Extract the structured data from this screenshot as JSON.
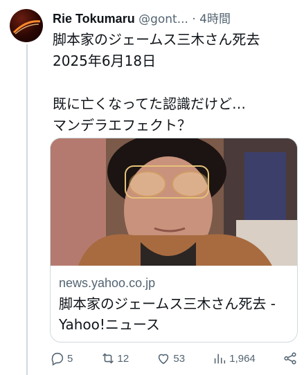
{
  "tweet": {
    "display_name": "Rie Tokumaru",
    "handle": "@gont...",
    "separator": "·",
    "time": "4時間",
    "text": "脚本家のジェームス三木さん死去\n2025年6月18日\n\n既に亡くなってた認識だけど…\nマンデラエフェクト？"
  },
  "card": {
    "domain": "news.yahoo.co.jp",
    "title": "脚本家のジェームス三木さん死去 - Yahoo!ニュース"
  },
  "actions": {
    "replies": "5",
    "reposts": "12",
    "likes": "53",
    "views": "1,964"
  },
  "icons": {
    "reply": "reply-icon",
    "repost": "repost-icon",
    "like": "heart-icon",
    "views": "views-icon",
    "share": "share-icon"
  }
}
